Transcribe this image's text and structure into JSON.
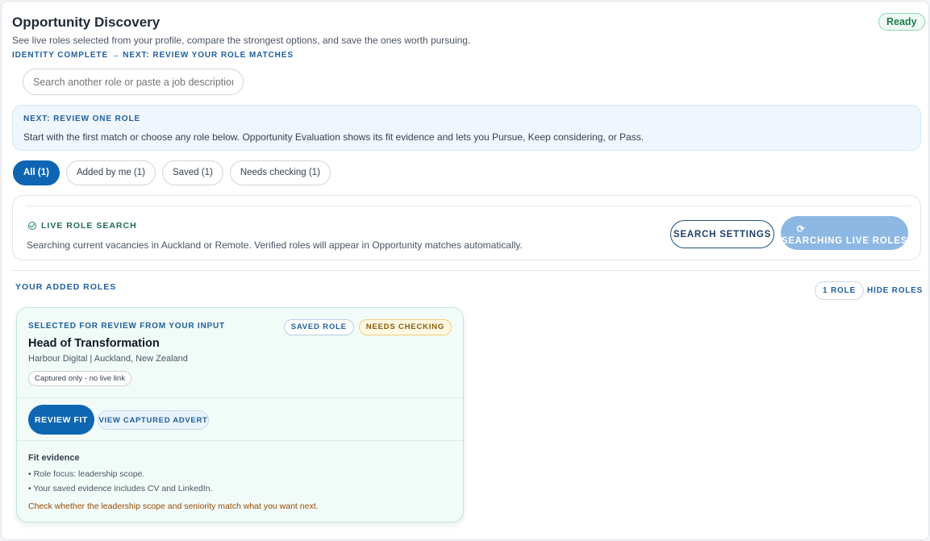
{
  "header": {
    "title": "Opportunity Discovery",
    "status": "Ready",
    "subtitle": "See live roles selected from your profile, compare the strongest options, and save the ones worth pursuing.",
    "stage": "IDENTITY COMPLETE → NEXT: REVIEW YOUR ROLE MATCHES"
  },
  "search": {
    "placeholder": "Search another role or paste a job description",
    "value": ""
  },
  "next_step": {
    "kicker": "NEXT: REVIEW ONE ROLE",
    "text": "Start with the first match or choose any role below. Opportunity Evaluation shows its fit evidence and lets you Pursue, Keep considering, or Pass."
  },
  "filters": [
    {
      "label": "All (1)",
      "active": true
    },
    {
      "label": "Added by me (1)",
      "active": false
    },
    {
      "label": "Saved (1)",
      "active": false
    },
    {
      "label": "Needs checking (1)",
      "active": false
    }
  ],
  "live_search": {
    "kicker": "LIVE ROLE SEARCH",
    "text": "Searching current vacancies in Auckland or Remote. Verified roles will appear in Opportunity matches automatically.",
    "settings_label": "SEARCH SETTINGS",
    "searching_label": "SEARCHING LIVE ROLES",
    "spinner_icon": "refresh-icon"
  },
  "added_roles": {
    "title": "YOUR ADDED ROLES",
    "count_label": "1 ROLE",
    "hide_label": "HIDE ROLES",
    "card": {
      "kicker": "SELECTED FOR REVIEW FROM YOUR INPUT",
      "badge_saved": "SAVED ROLE",
      "badge_check": "NEEDS CHECKING",
      "title": "Head of Transformation",
      "company": "Harbour Digital | Auckland, New Zealand",
      "captured": "Captured only - no live link",
      "review_label": "REVIEW FIT",
      "view_label": "VIEW CAPTURED ADVERT",
      "fit_title": "Fit evidence",
      "fit_items": [
        "• Role focus: leadership scope.",
        "• Your saved evidence includes CV and LinkedIn."
      ],
      "note": "Check whether the leadership scope and seniority match what you want next."
    }
  },
  "colors": {
    "accent": "#0e66b3",
    "ready_green": "#1f7a4b",
    "warning": "#9a4a06",
    "card_bg": "#f1fbf8"
  }
}
